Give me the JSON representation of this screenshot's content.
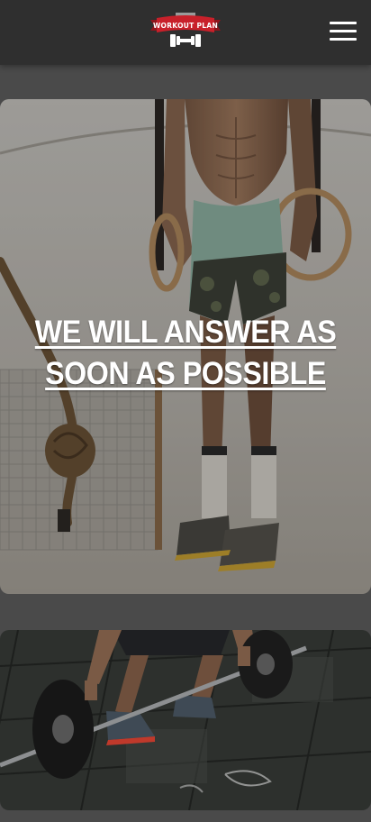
{
  "header": {
    "logo_text": "WORKOUT PLAN",
    "logo_icon": "dumbbell-icon",
    "menu_icon": "hamburger-menu-icon"
  },
  "hero": {
    "title_line1": "WE WILL ANSWER AS",
    "title_line2": "SOON AS POSSIBLE",
    "image": "gym-rings-athlete-photo"
  },
  "second_card": {
    "image": "barbell-deadlift-photo"
  },
  "colors": {
    "header_bg": "#2f2f2f",
    "page_bg": "#4a4a4a",
    "logo_red": "#c8202a",
    "text_white": "#ffffff"
  }
}
